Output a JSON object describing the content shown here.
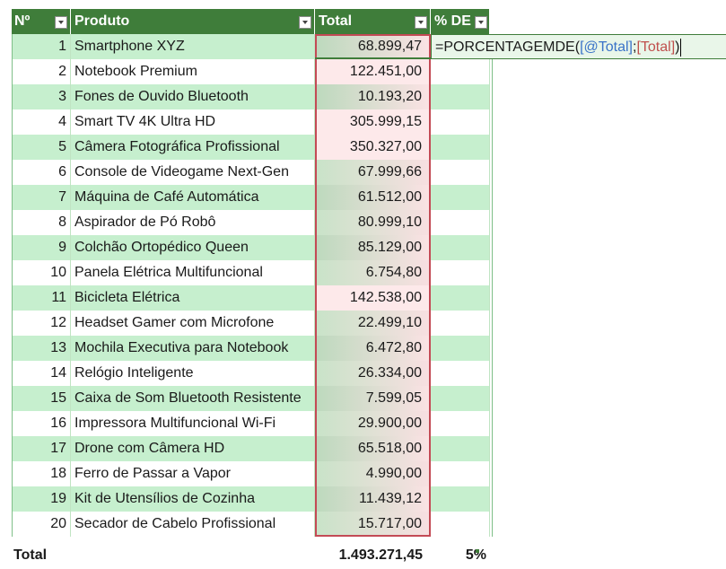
{
  "columns": {
    "num": "Nº",
    "produto": "Produto",
    "total": "Total",
    "pct": "% DE"
  },
  "rows": [
    {
      "n": "1",
      "produto": "Smartphone XYZ",
      "total": "68.899,47"
    },
    {
      "n": "2",
      "produto": "Notebook Premium",
      "total": "122.451,00"
    },
    {
      "n": "3",
      "produto": "Fones de Ouvido Bluetooth",
      "total": "10.193,20"
    },
    {
      "n": "4",
      "produto": "Smart TV 4K Ultra HD",
      "total": "305.999,15"
    },
    {
      "n": "5",
      "produto": "Câmera Fotográfica Profissional",
      "total": "350.327,00"
    },
    {
      "n": "6",
      "produto": "Console de Videogame Next-Gen",
      "total": "67.999,66"
    },
    {
      "n": "7",
      "produto": "Máquina de Café Automática",
      "total": "61.512,00"
    },
    {
      "n": "8",
      "produto": "Aspirador de Pó Robô",
      "total": "80.999,10"
    },
    {
      "n": "9",
      "produto": "Colchão Ortopédico Queen",
      "total": "85.129,00"
    },
    {
      "n": "10",
      "produto": "Panela Elétrica Multifuncional",
      "total": "6.754,80"
    },
    {
      "n": "11",
      "produto": "Bicicleta Elétrica",
      "total": "142.538,00"
    },
    {
      "n": "12",
      "produto": "Headset Gamer com Microfone",
      "total": "22.499,10"
    },
    {
      "n": "13",
      "produto": "Mochila Executiva para Notebook",
      "total": "6.472,80"
    },
    {
      "n": "14",
      "produto": "Relógio Inteligente",
      "total": "26.334,00"
    },
    {
      "n": "15",
      "produto": "Caixa de Som Bluetooth Resistente",
      "total": "7.599,05"
    },
    {
      "n": "16",
      "produto": "Impressora Multifuncional Wi-Fi",
      "total": "29.900,00"
    },
    {
      "n": "17",
      "produto": "Drone com Câmera HD",
      "total": "65.518,00"
    },
    {
      "n": "18",
      "produto": "Ferro de Passar a Vapor",
      "total": "4.990,00"
    },
    {
      "n": "19",
      "produto": "Kit de Utensílios de Cozinha",
      "total": "11.439,12"
    },
    {
      "n": "20",
      "produto": "Secador de Cabelo Profissional",
      "total": "15.717,00"
    }
  ],
  "formula": {
    "prefix": "=PORCENTAGEMDE(",
    "ref1": "[@Total]",
    "sep": ";",
    "ref2": "[Total]",
    "suffix": ")"
  },
  "totals": {
    "label": "Total",
    "total": "1.493.271,45",
    "pct": "5%"
  },
  "colors": {
    "header": "#3f7d3a",
    "band": "#c6efce",
    "selection": "#c34a55"
  }
}
